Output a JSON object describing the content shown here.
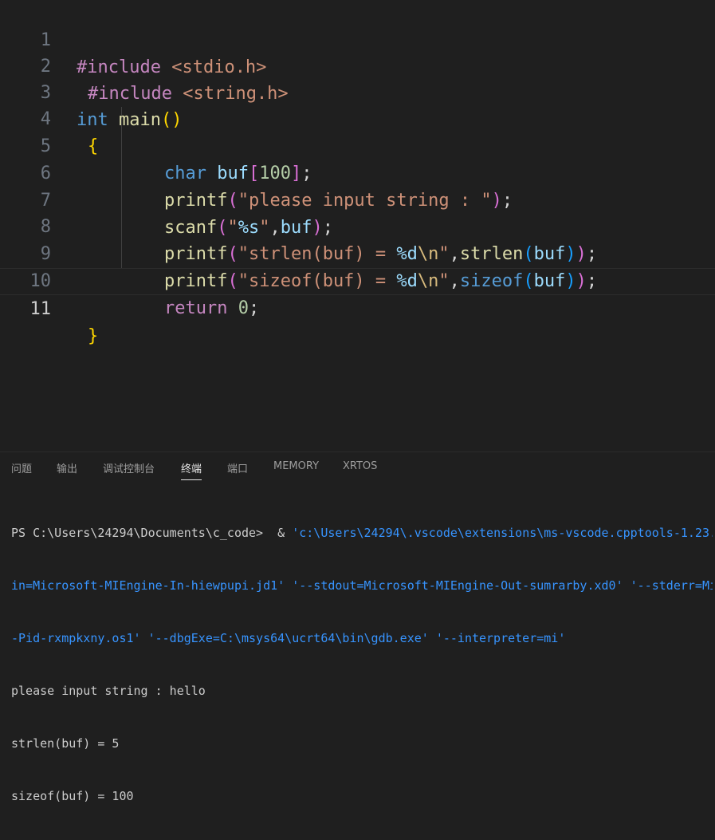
{
  "editor": {
    "line_numbers": [
      "1",
      "2",
      "3",
      "4",
      "5",
      "6",
      "7",
      "8",
      "9",
      "10",
      "11"
    ],
    "tokens": {
      "l1": [
        "#include",
        " ",
        "<stdio.h>"
      ],
      "l2": [
        "#include",
        " ",
        "<string.h>"
      ],
      "l3": [
        "int",
        " ",
        "main",
        "(",
        ")"
      ],
      "l4": [
        "{"
      ],
      "l5": [
        "char",
        " ",
        "buf",
        "[",
        "100",
        "]",
        ";"
      ],
      "l6": [
        "printf",
        "(",
        "\"please input string : \"",
        ")",
        ";"
      ],
      "l7": [
        "scanf",
        "(",
        "\"",
        "%s",
        "\"",
        ",",
        "buf",
        ")",
        ";"
      ],
      "l8": [
        "printf",
        "(",
        "\"strlen(buf) = ",
        "%d",
        "\\n",
        "\"",
        ",",
        "strlen",
        "(",
        "buf",
        ")",
        ")",
        ";"
      ],
      "l9": [
        "printf",
        "(",
        "\"sizeof(buf) = ",
        "%d",
        "\\n",
        "\"",
        ",",
        "sizeof",
        "(",
        "buf",
        ")",
        ")",
        ";"
      ],
      "l10": [
        "return",
        " ",
        "0",
        ";"
      ],
      "l11": [
        "}"
      ]
    }
  },
  "panel": {
    "tabs": [
      "问题",
      "输出",
      "调试控制台",
      "终端",
      "端口",
      "MEMORY",
      "XRTOS"
    ],
    "active_tab": "终端"
  },
  "terminal": {
    "prompt": "PS C:\\Users\\24294\\Documents\\c_code>  & ",
    "command_start": "'c:\\Users\\24294\\.vscode\\extensions\\ms-vscode.cpptools-1.23.",
    "line2": "in=Microsoft-MIEngine-In-hiewpupi.jd1' '--stdout=Microsoft-MIEngine-Out-sumrarby.xd0' '--stderr=Mi",
    "line3": "-Pid-rxmpkxny.os1' '--dbgExe=C:\\msys64\\ucrt64\\bin\\gdb.exe' '--interpreter=mi'",
    "output": [
      "please input string : hello",
      "strlen(buf) = 5",
      "sizeof(buf) = 100"
    ]
  }
}
